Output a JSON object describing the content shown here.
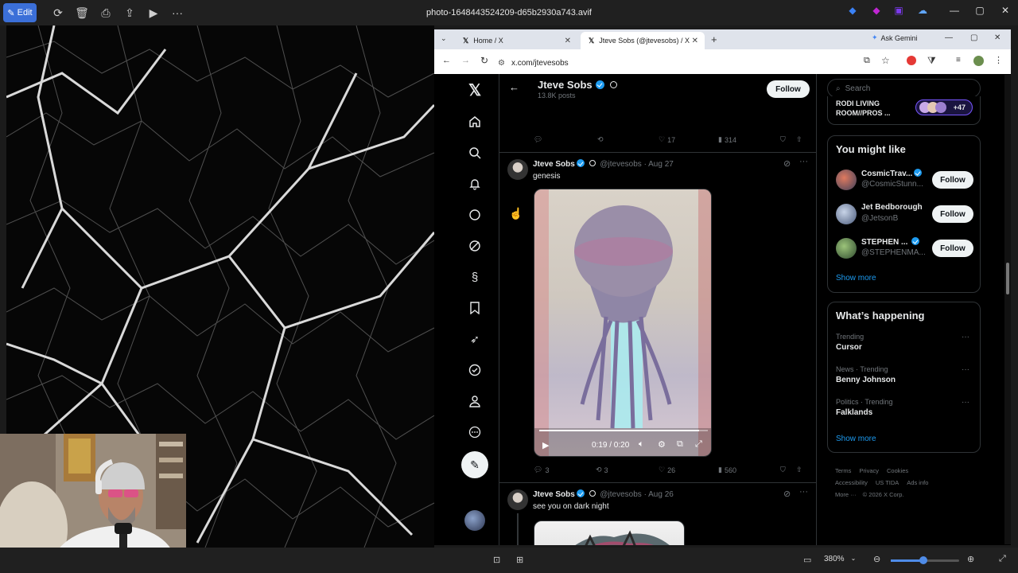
{
  "viewer": {
    "edit_label": "Edit",
    "title": "photo-1648443524209-d65b2930a743.avif",
    "zoom": "380%"
  },
  "browser": {
    "tabs": [
      {
        "label": "Home / X"
      },
      {
        "label": "Jteve Sobs (@jtevesobs) / X"
      }
    ],
    "ask_gemini": "Ask Gemini",
    "url": "x.com/jtevesobs"
  },
  "profile": {
    "name": "Jteve Sobs",
    "posts_count": "13.8K posts",
    "follow_label": "Follow"
  },
  "prev_post_actions": {
    "replies": "",
    "reposts": "",
    "likes": "17",
    "views": "314"
  },
  "posts": [
    {
      "name": "Jteve Sobs",
      "handle": "@jtevesobs",
      "date": "· Aug 27",
      "text": "genesis",
      "video_time": "0:19 / 0:20",
      "video_progress": 0.95,
      "replies": "3",
      "reposts": "3",
      "likes": "26",
      "views": "560"
    },
    {
      "name": "Jteve Sobs",
      "handle": "@jtevesobs",
      "date": "· Aug 26",
      "text": "see you on dark night"
    }
  ],
  "sidebar": {
    "search_placeholder": "Search",
    "space_title_line1": "RODI LIVING",
    "space_title_line2": "ROOM//PROS ...",
    "space_count": "+47",
    "you_might_like_title": "You might like",
    "suggestions": [
      {
        "name": "CosmicTrav...",
        "handle": "@CosmicStunn...",
        "verified": true
      },
      {
        "name": "Jet Bedborough",
        "handle": "@JetsonB",
        "verified": false
      },
      {
        "name": "STEPHEN ...",
        "handle": "@STEPHENMA...",
        "verified": true
      }
    ],
    "follow_label": "Follow",
    "show_more": "Show more",
    "whats_happening_title": "What’s happening",
    "trends": [
      {
        "context": "Trending",
        "topic": "Cursor"
      },
      {
        "context": "News · Trending",
        "topic": "Benny Johnson"
      },
      {
        "context": "Politics · Trending",
        "topic": "Falklands"
      }
    ],
    "footer": {
      "terms": "Terms",
      "privacy": "Privacy",
      "cookies": "Cookies",
      "accessibility": "Accessibility",
      "us_tida": "US TIDA",
      "ads_info": "Ads info",
      "more": "More ···",
      "copyright": "© 2026 X Corp."
    }
  }
}
